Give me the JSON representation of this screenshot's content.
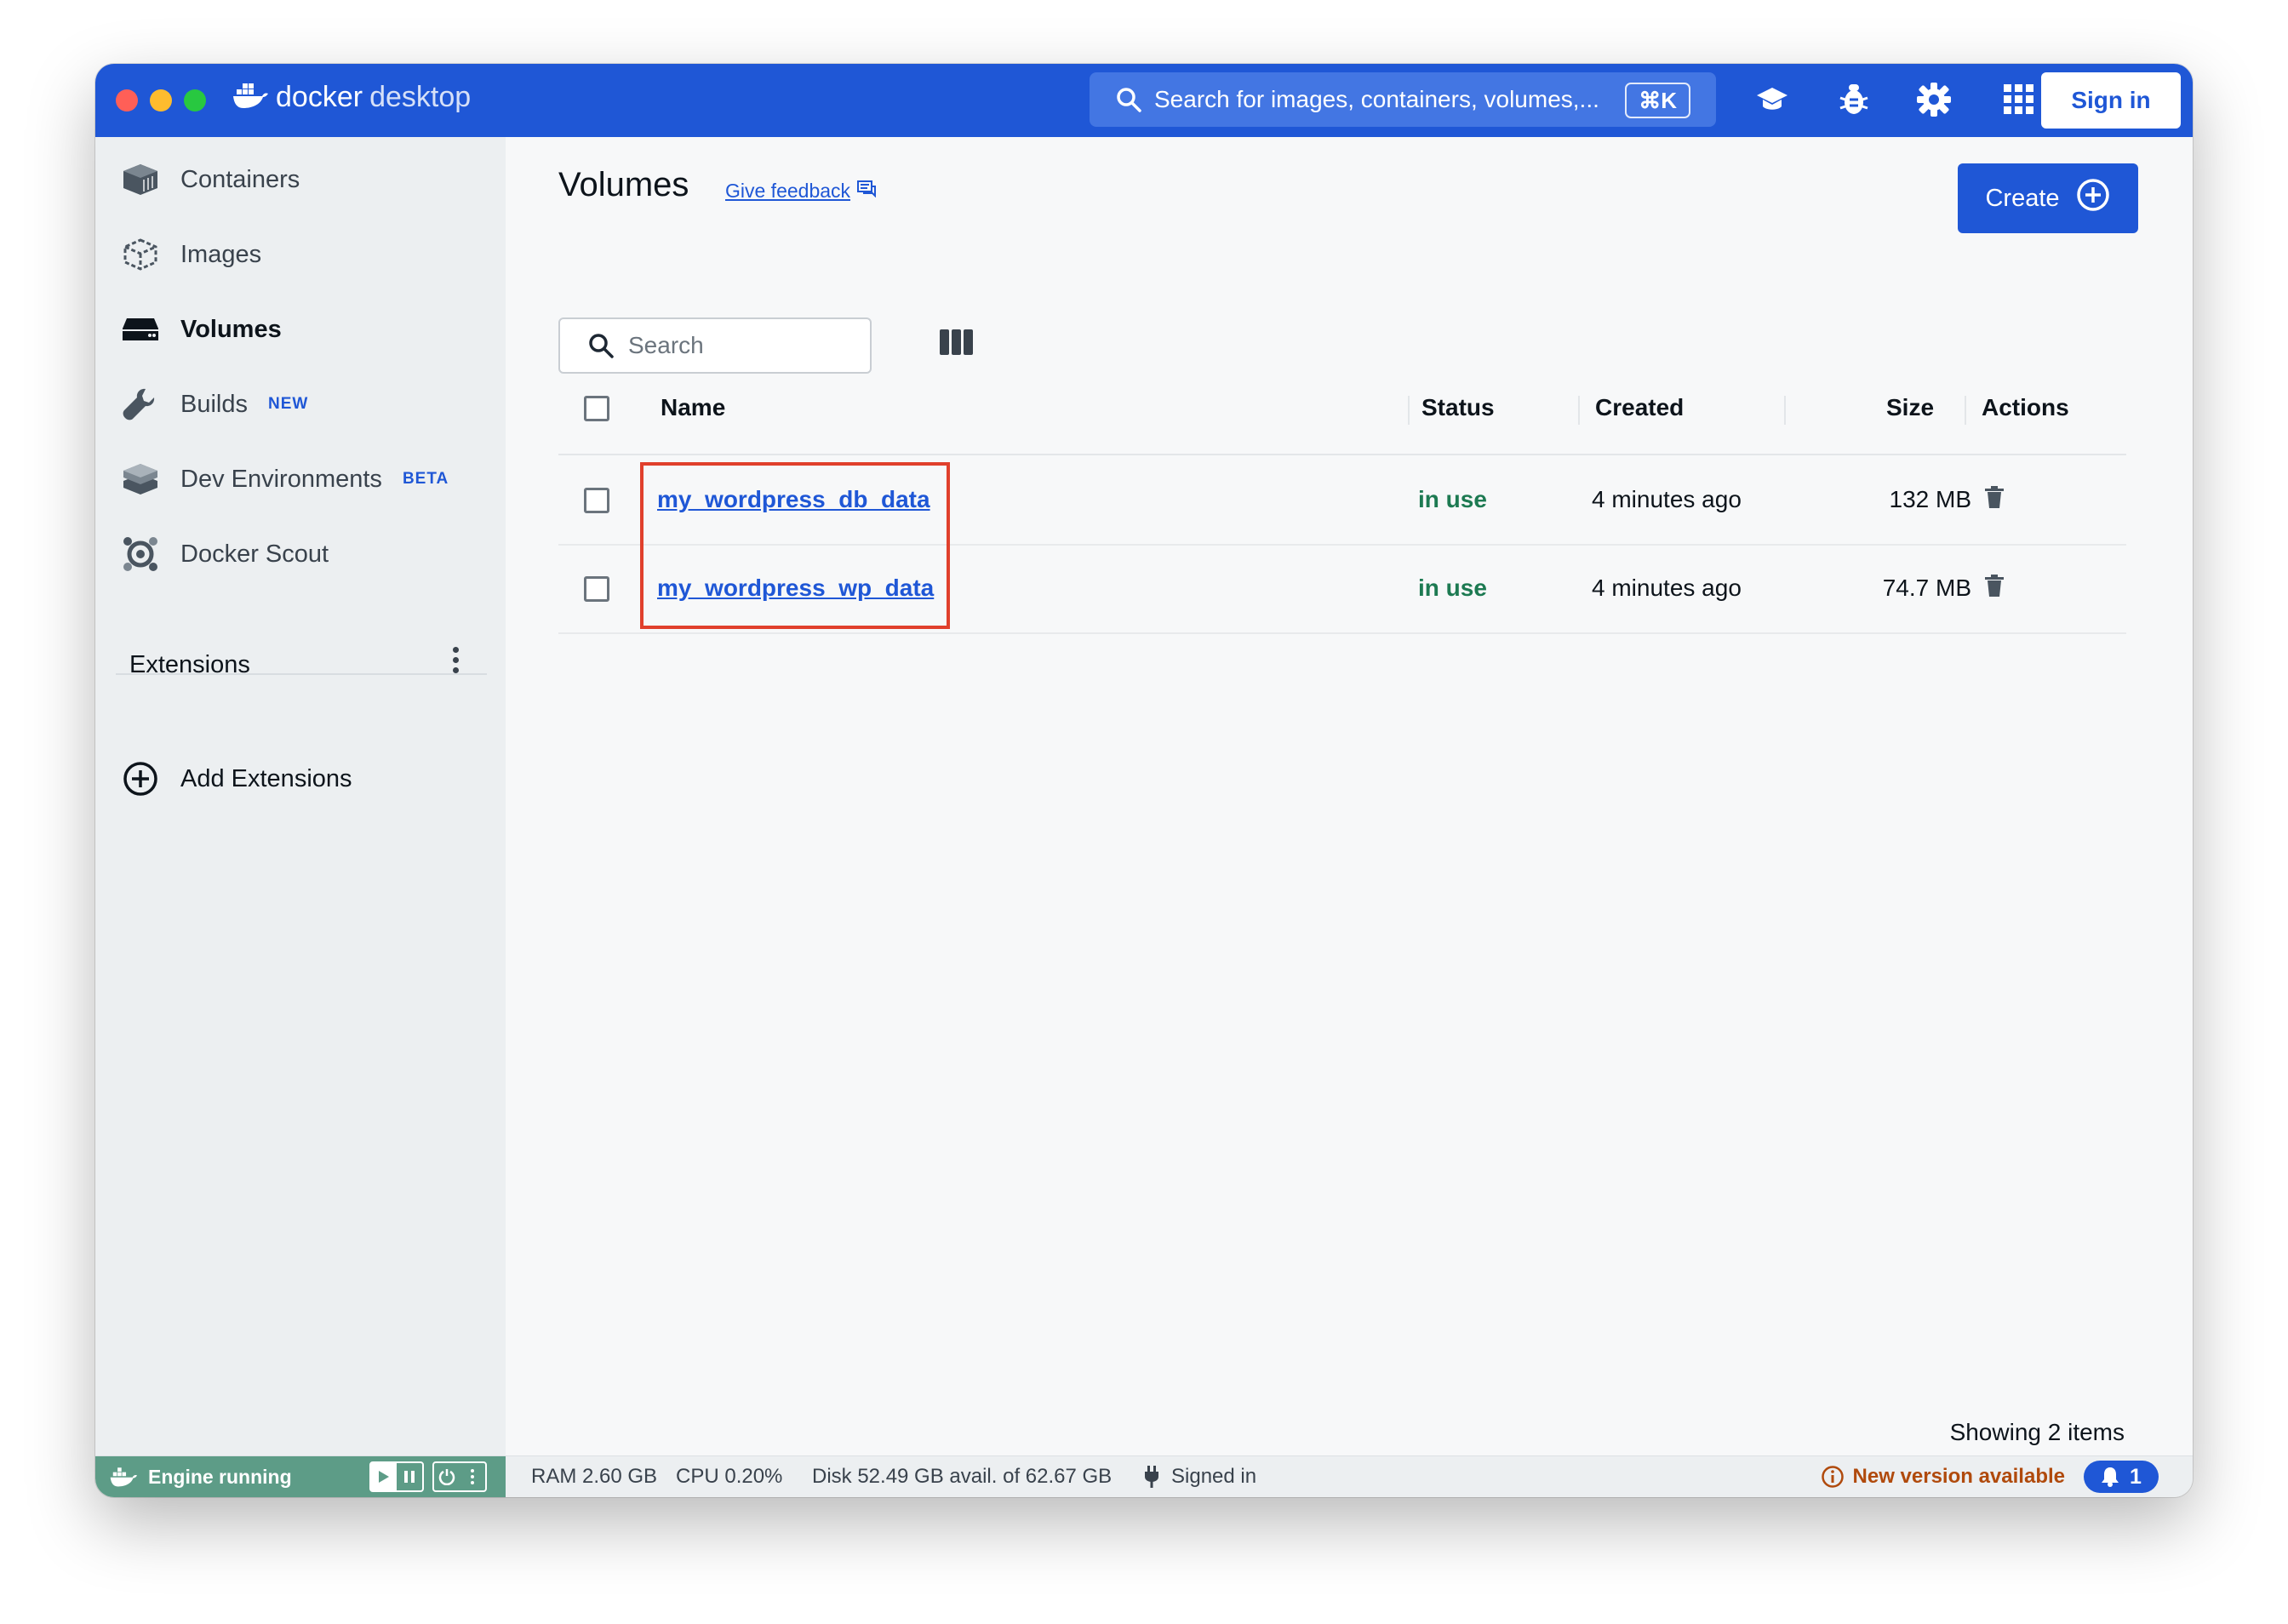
{
  "app": {
    "brand_docker": "docker",
    "brand_desktop": "desktop",
    "global_search_placeholder": "Search for images, containers, volumes,...",
    "shortcut": "⌘K",
    "sign_in_label": "Sign in"
  },
  "sidebar": {
    "items": [
      {
        "label": "Containers",
        "icon": "container-icon",
        "active": false,
        "badge": ""
      },
      {
        "label": "Images",
        "icon": "image-icon",
        "active": false,
        "badge": ""
      },
      {
        "label": "Volumes",
        "icon": "volume-icon",
        "active": true,
        "badge": ""
      },
      {
        "label": "Builds",
        "icon": "wrench-icon",
        "active": false,
        "badge": "NEW"
      },
      {
        "label": "Dev Environments",
        "icon": "dev-env-icon",
        "active": false,
        "badge": "BETA"
      },
      {
        "label": "Docker Scout",
        "icon": "scout-icon",
        "active": false,
        "badge": ""
      }
    ],
    "extensions_title": "Extensions",
    "add_extensions_label": "Add Extensions"
  },
  "main": {
    "title": "Volumes",
    "feedback_label": "Give feedback",
    "create_label": "Create",
    "search_placeholder": "Search",
    "columns": {
      "name": "Name",
      "status": "Status",
      "created": "Created",
      "size": "Size",
      "actions": "Actions"
    },
    "rows": [
      {
        "name": "my_wordpress_db_data",
        "status": "in use",
        "created": "4 minutes ago",
        "size": "132 MB"
      },
      {
        "name": "my_wordpress_wp_data",
        "status": "in use",
        "created": "4 minutes ago",
        "size": "74.7 MB"
      }
    ],
    "showing_label": "Showing 2 items"
  },
  "footer": {
    "engine_status": "Engine running",
    "ram": "RAM 2.60 GB",
    "cpu": "CPU 0.20%",
    "disk": "Disk 52.49 GB avail. of 62.67 GB",
    "signed_in": "Signed in",
    "new_version": "New version available",
    "notification_count": "1"
  },
  "colors": {
    "accent": "#1f57d6",
    "status_in_use": "#1d7a52",
    "engine_running": "#5d9c87",
    "highlight_box": "#e0402c",
    "warning": "#b04a0c"
  }
}
